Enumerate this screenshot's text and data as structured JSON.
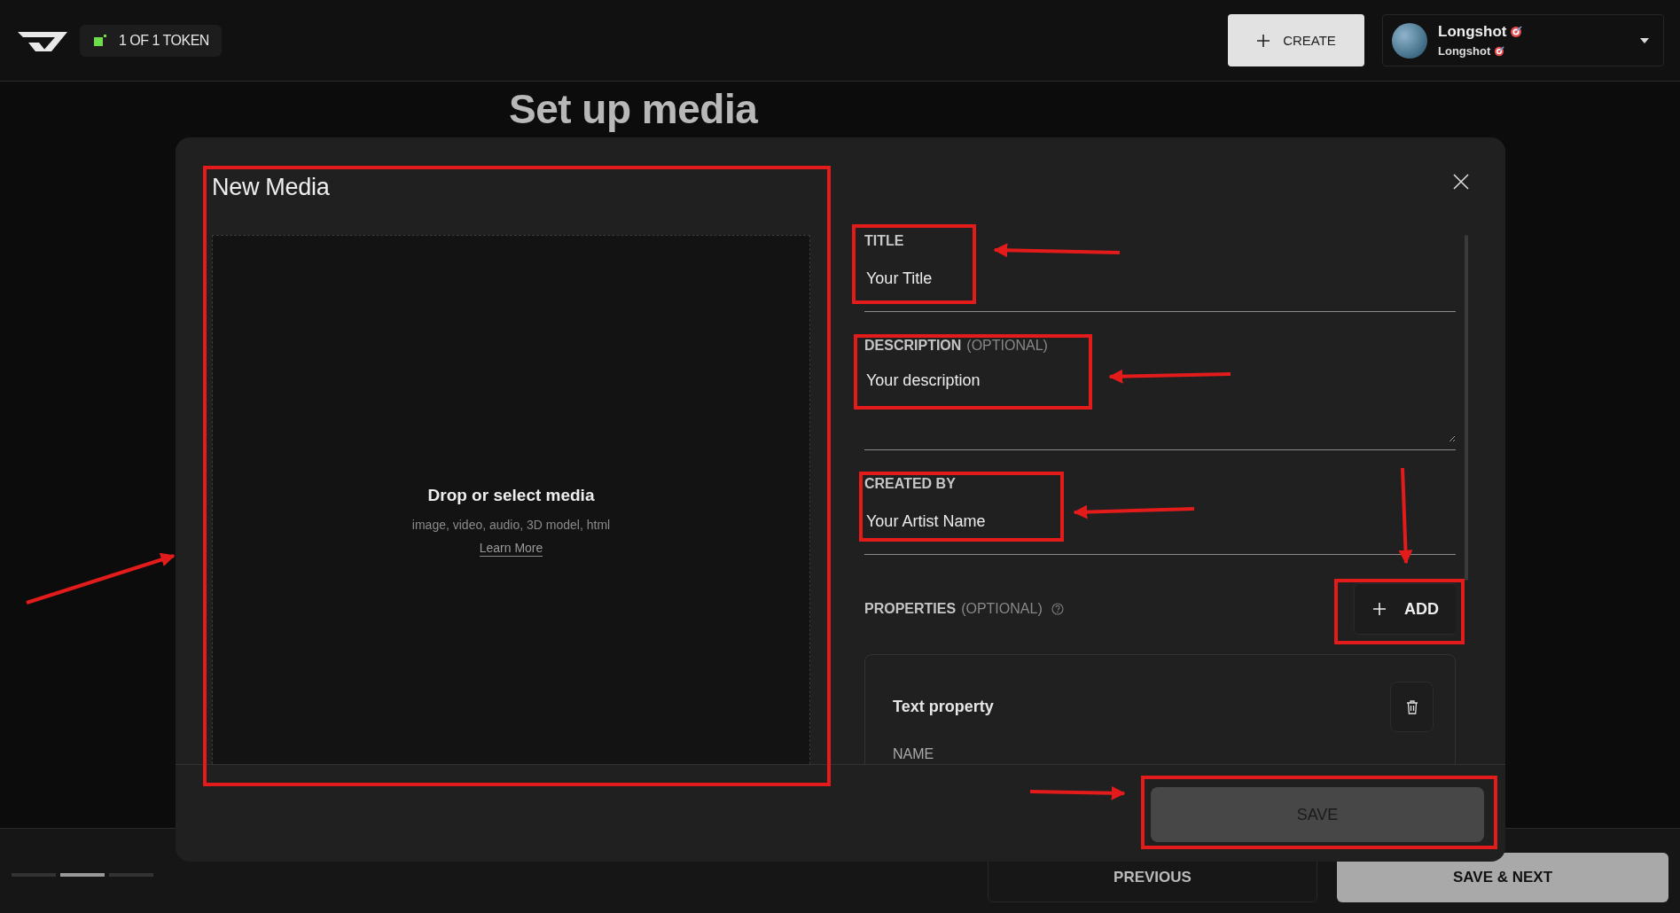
{
  "header": {
    "token_badge": "1 OF 1 TOKEN",
    "create_button": "CREATE",
    "profile": {
      "name": "Longshot",
      "handle": "Longshot"
    }
  },
  "page": {
    "heading": "Set up media"
  },
  "modal": {
    "title": "New Media",
    "dropzone": {
      "heading": "Drop or select media",
      "formats": "image, video, audio, 3D model, html",
      "link": "Learn More"
    },
    "fields": [
      {
        "label": "TITLE",
        "placeholder": "Your Title",
        "kind": "input"
      },
      {
        "label": "DESCRIPTION",
        "optional": "(OPTIONAL)",
        "placeholder": "Your description",
        "kind": "textarea"
      },
      {
        "label": "CREATED BY",
        "placeholder": "Your Artist Name",
        "kind": "input"
      }
    ],
    "properties": {
      "label": "PROPERTIES",
      "optional": "(OPTIONAL)",
      "add_button": "ADD",
      "items": [
        {
          "title": "Text property",
          "field_label": "NAME"
        }
      ]
    },
    "save_button": {
      "label": "SAVE",
      "disabled": true
    }
  },
  "footer": {
    "steps": [
      {
        "selected": false
      },
      {
        "selected": true
      },
      {
        "selected": false
      }
    ],
    "previous_button": "PREVIOUS",
    "next_button": "SAVE & NEXT"
  }
}
